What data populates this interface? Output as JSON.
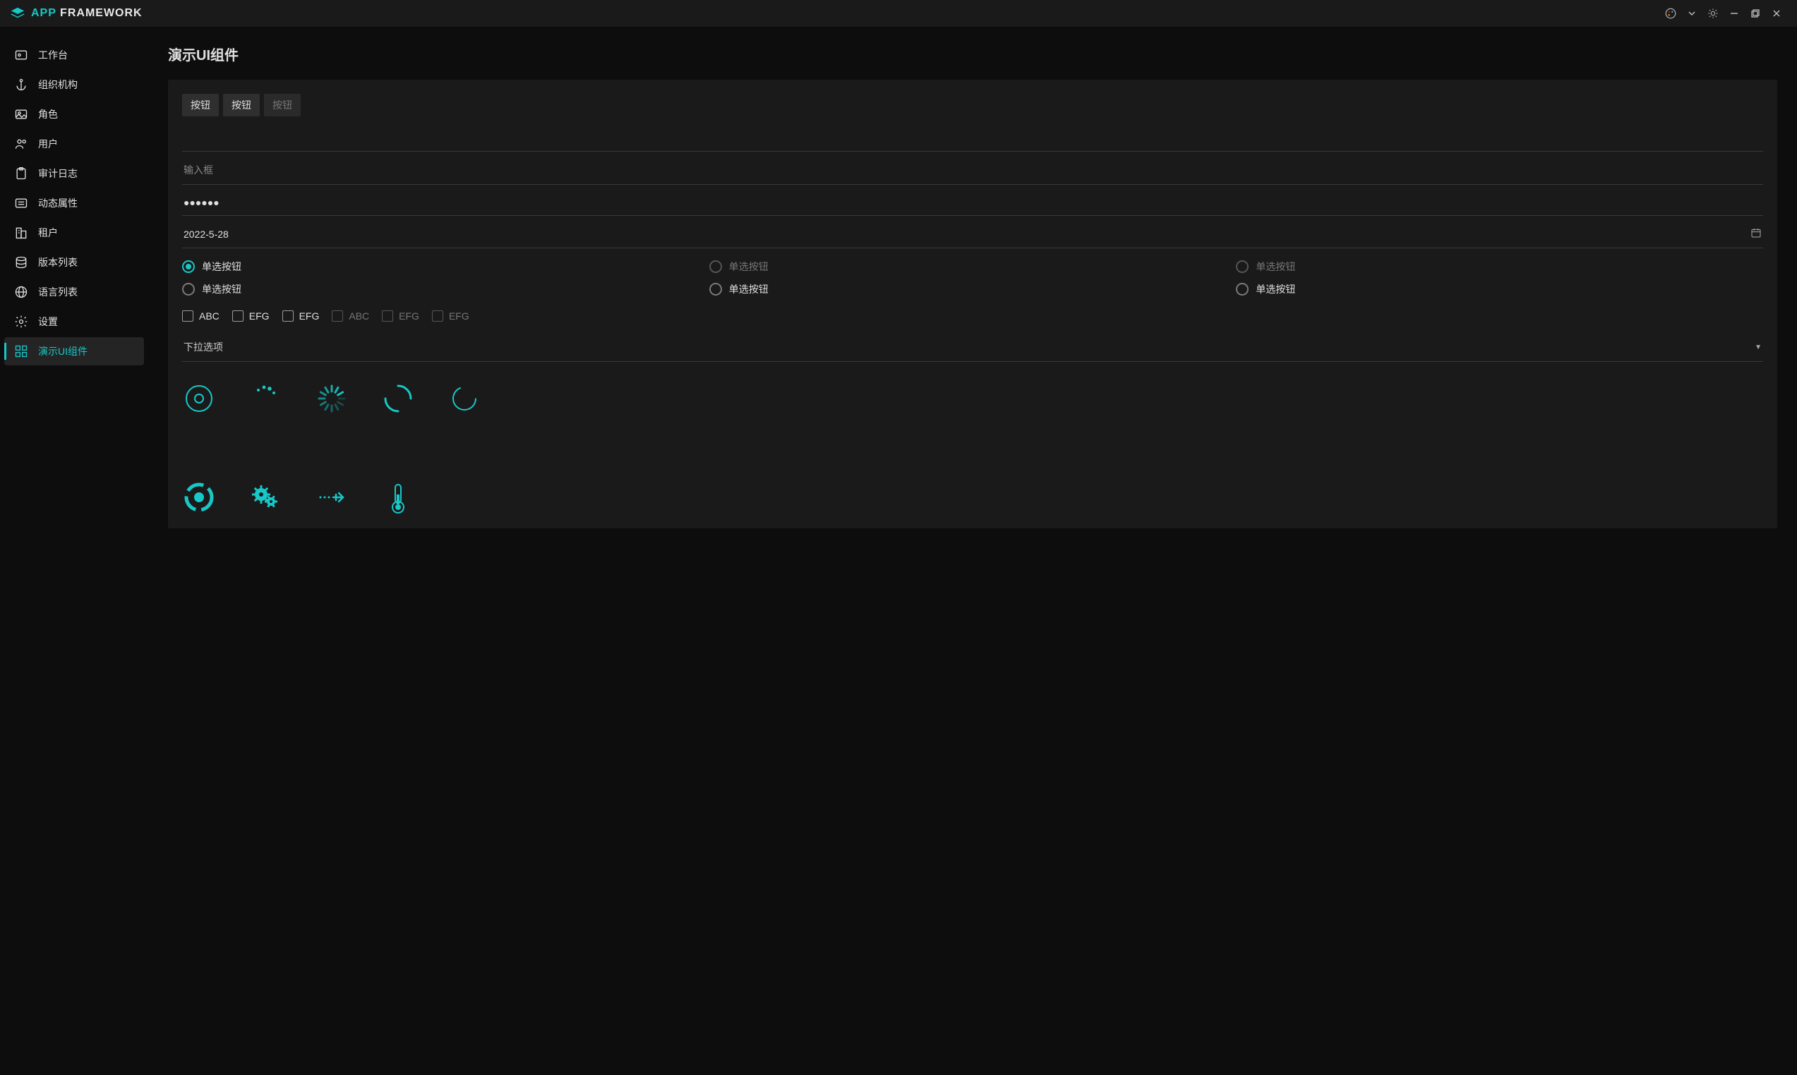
{
  "app": {
    "logo_accent": "APP",
    "logo_rest": " FRAMEWORK"
  },
  "titlebar_icons": [
    "palette",
    "caret-down",
    "brightness",
    "minimize",
    "maximize",
    "close"
  ],
  "sidebar": {
    "items": [
      {
        "icon": "dashboard",
        "label": "工作台"
      },
      {
        "icon": "anchor",
        "label": "组织机构"
      },
      {
        "icon": "image",
        "label": "角色"
      },
      {
        "icon": "users",
        "label": "用户"
      },
      {
        "icon": "clipboard",
        "label": "审计日志"
      },
      {
        "icon": "list",
        "label": "动态属性"
      },
      {
        "icon": "building",
        "label": "租户"
      },
      {
        "icon": "database",
        "label": "版本列表"
      },
      {
        "icon": "globe",
        "label": "语言列表"
      },
      {
        "icon": "gear",
        "label": "设置"
      },
      {
        "icon": "grid",
        "label": "演示UI组件",
        "active": true
      }
    ]
  },
  "page": {
    "title": "演示UI组件",
    "buttons": [
      {
        "label": "按钮",
        "disabled": false
      },
      {
        "label": "按钮",
        "disabled": false
      },
      {
        "label": "按钮",
        "disabled": true
      }
    ],
    "text_input_value": "",
    "placeholder_input": "输入框",
    "password_value": "●●●●●●",
    "date_value": "2022-5-28",
    "radios": [
      {
        "label": "单选按钮",
        "selected": true,
        "disabled": false
      },
      {
        "label": "单选按钮",
        "selected": false,
        "disabled": true
      },
      {
        "label": "单选按钮",
        "selected": false,
        "disabled": true
      },
      {
        "label": "单选按钮",
        "selected": false,
        "disabled": false
      },
      {
        "label": "单选按钮",
        "selected": false,
        "disabled": false
      },
      {
        "label": "单选按钮",
        "selected": false,
        "disabled": false
      }
    ],
    "checks": [
      {
        "label": "ABC",
        "disabled": false
      },
      {
        "label": "EFG",
        "disabled": false
      },
      {
        "label": "EFG",
        "disabled": false
      },
      {
        "label": "ABC",
        "disabled": true
      },
      {
        "label": "EFG",
        "disabled": true
      },
      {
        "label": "EFG",
        "disabled": true
      }
    ],
    "select_label": "下拉选项",
    "spinners": [
      "ring",
      "dots",
      "segments",
      "arc",
      "thin-ring",
      "pie",
      "gears",
      "plane",
      "thermometer"
    ]
  },
  "colors": {
    "accent": "#17c8c8"
  }
}
